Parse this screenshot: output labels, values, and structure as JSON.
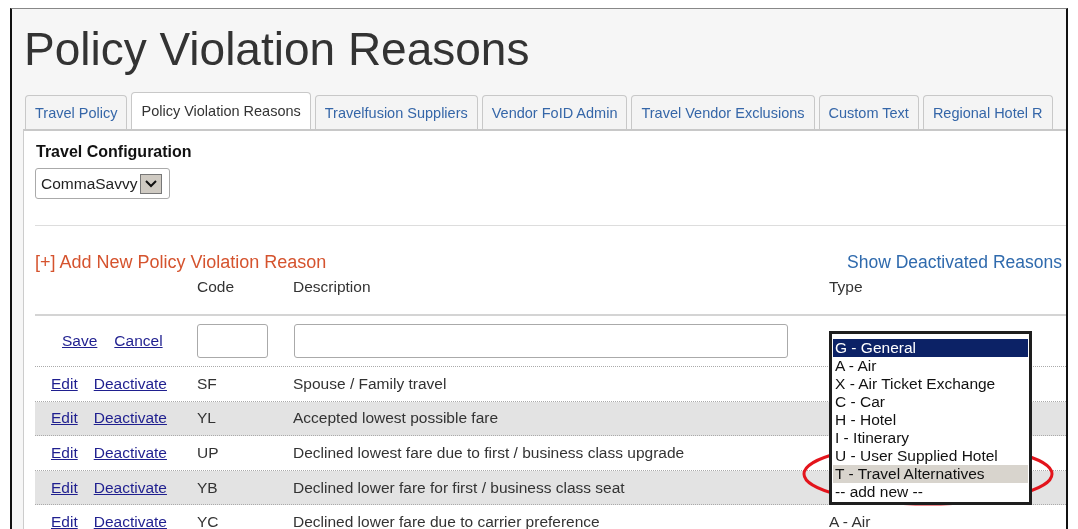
{
  "page_title": "Policy Violation Reasons",
  "tabs": [
    {
      "label": "Travel Policy",
      "selected": false
    },
    {
      "label": "Policy Violation Reasons",
      "selected": true
    },
    {
      "label": "Travelfusion Suppliers",
      "selected": false
    },
    {
      "label": "Vendor FoID Admin",
      "selected": false
    },
    {
      "label": "Travel Vendor Exclusions",
      "selected": false
    },
    {
      "label": "Custom Text",
      "selected": false
    },
    {
      "label": "Regional Hotel R",
      "selected": false
    }
  ],
  "travel_configuration": {
    "label": "Travel Configuration",
    "value": "CommaSavvy"
  },
  "add_link": "[+] Add New Policy Violation Reason",
  "show_deactivated_link": "Show Deactivated Reasons",
  "table": {
    "columns": [
      "Code",
      "Description",
      "Type"
    ],
    "new_row": {
      "save": "Save",
      "cancel": "Cancel"
    },
    "rows": [
      {
        "edit": "Edit",
        "deactivate": "Deactivate",
        "code": "SF",
        "description": "Spouse / Family travel"
      },
      {
        "edit": "Edit",
        "deactivate": "Deactivate",
        "code": "YL",
        "description": "Accepted lowest possible fare"
      },
      {
        "edit": "Edit",
        "deactivate": "Deactivate",
        "code": "UP",
        "description": "Declined lowest fare due to first / business class upgrade"
      },
      {
        "edit": "Edit",
        "deactivate": "Deactivate",
        "code": "YB",
        "description": "Declined lower fare for first / business class seat"
      },
      {
        "edit": "Edit",
        "deactivate": "Deactivate",
        "code": "YC",
        "description": "Declined lower fare due to carrier preference",
        "type": "A - Air"
      }
    ]
  },
  "type_dropdown": {
    "options": [
      {
        "label": "G - General",
        "selected": true,
        "highlighted": false
      },
      {
        "label": "A - Air",
        "selected": false,
        "highlighted": false
      },
      {
        "label": "X - Air Ticket Exchange",
        "selected": false,
        "highlighted": false
      },
      {
        "label": "C - Car",
        "selected": false,
        "highlighted": false
      },
      {
        "label": "H - Hotel",
        "selected": false,
        "highlighted": false
      },
      {
        "label": "I - Itinerary",
        "selected": false,
        "highlighted": false
      },
      {
        "label": "U - User Supplied Hotel",
        "selected": false,
        "highlighted": false
      },
      {
        "label": "T - Travel Alternatives",
        "selected": false,
        "highlighted": true
      },
      {
        "label": "-- add new --",
        "selected": false,
        "highlighted": false
      }
    ]
  }
}
